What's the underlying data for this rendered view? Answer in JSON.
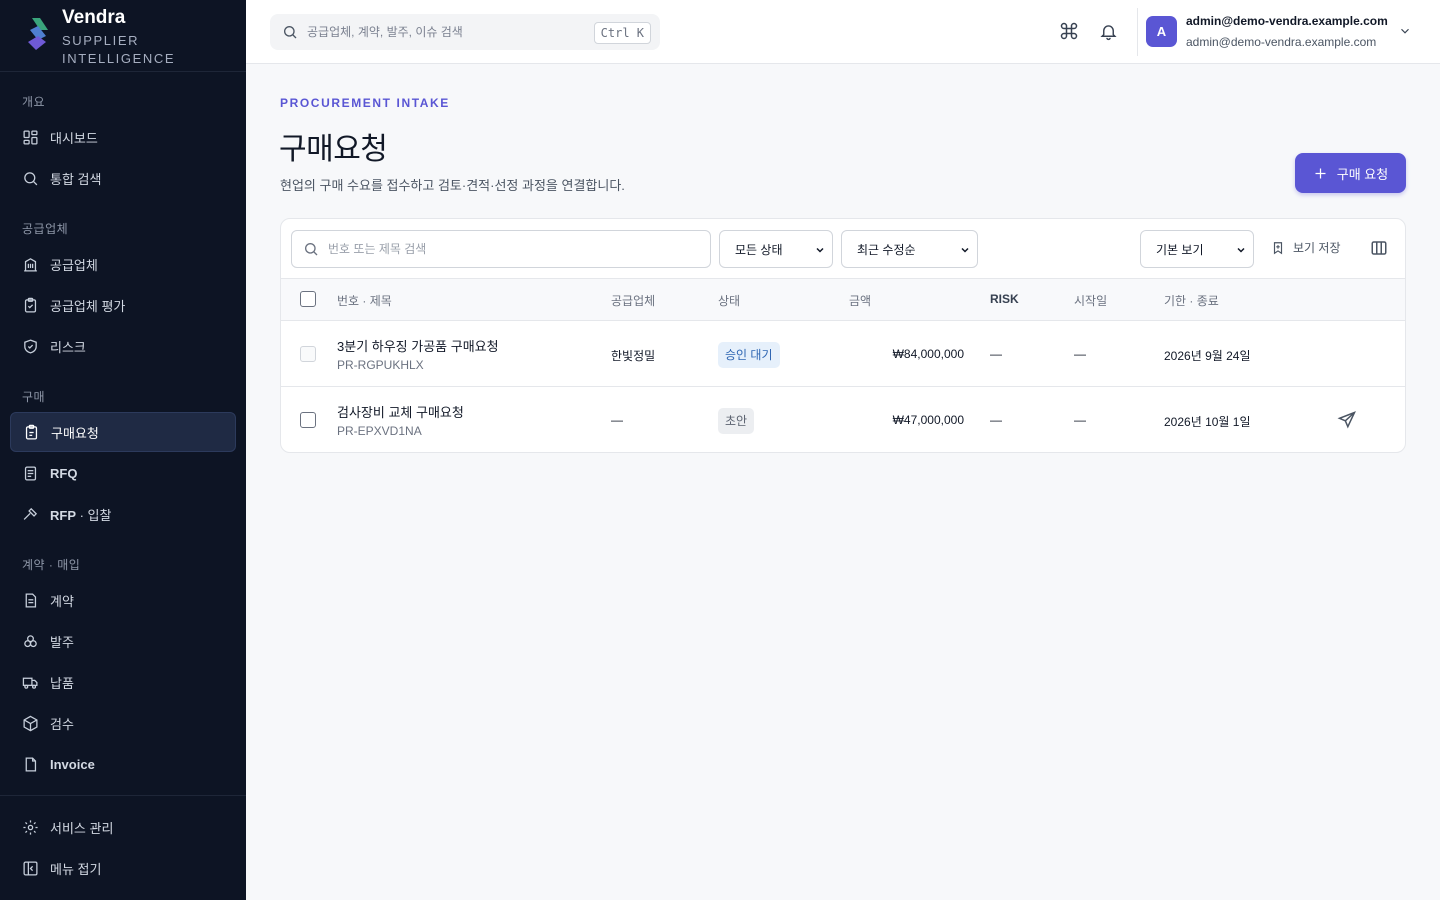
{
  "brand": {
    "name": "Vendra",
    "tagline": "SUPPLIER INTELLIGENCE",
    "logo_colors": [
      "#3aa57c",
      "#6f5ad6"
    ]
  },
  "sidebar": {
    "sections": [
      {
        "title": "개요",
        "items": [
          {
            "label": "대시보드",
            "icon": "dashboard-icon"
          },
          {
            "label": "통합 검색",
            "icon": "search-icon"
          }
        ]
      },
      {
        "title": "공급업체",
        "items": [
          {
            "label": "공급업체",
            "icon": "building-icon"
          },
          {
            "label": "공급업체 평가",
            "icon": "clipboard-check-icon"
          },
          {
            "label": "리스크",
            "icon": "shield-icon"
          }
        ]
      },
      {
        "title": "구매",
        "items": [
          {
            "label": "구매요청",
            "icon": "clipboard-icon",
            "active": true
          },
          {
            "label": "RFQ",
            "icon": "document-icon"
          },
          {
            "label_prefix": "RFP",
            "label_suffix": " · 입찰",
            "icon": "gavel-icon"
          }
        ]
      },
      {
        "title": "계약 · 매입",
        "items": [
          {
            "label": "계약",
            "icon": "contract-icon"
          },
          {
            "label": "발주",
            "icon": "boxes-icon"
          },
          {
            "label": "납품",
            "icon": "truck-icon"
          },
          {
            "label": "검수",
            "icon": "package-icon"
          },
          {
            "label": "Invoice",
            "icon": "invoice-icon"
          }
        ]
      }
    ],
    "footer": [
      {
        "label": "서비스 관리",
        "icon": "gear-icon"
      },
      {
        "label": "메뉴 접기",
        "icon": "collapse-icon"
      }
    ]
  },
  "topbar": {
    "search_placeholder": "공급업체, 계약, 발주, 이슈 검색",
    "shortcut": "Ctrl K",
    "user": {
      "avatar_letter": "A",
      "name": "admin@demo-vendra.example.com",
      "email": "admin@demo-vendra.example.com"
    }
  },
  "page": {
    "eyebrow": "PROCUREMENT INTAKE",
    "title": "구매요청",
    "description": "현업의 구매 수요를 접수하고 검토·견적·선정 과정을 연결합니다.",
    "new_button": "구매 요청"
  },
  "filters": {
    "search_placeholder": "번호 또는 제목 검색",
    "status_selected": "모든 상태",
    "sort_selected": "최근 수정순",
    "view_selected": "기본 보기",
    "save_view_label": "보기 저장"
  },
  "table": {
    "headers": {
      "number_title": "번호 · 제목",
      "supplier": "공급업체",
      "status": "상태",
      "amount": "금액",
      "risk": "RISK",
      "start": "시작일",
      "due": "기한 · 종료"
    },
    "rows": [
      {
        "title": "3분기 하우징 가공품 구매요청",
        "id": "PR-RGPUKHLX",
        "supplier": "한빛정밀",
        "status": "승인 대기",
        "amount": "₩84,000,000",
        "risk": "—",
        "start": "—",
        "due": "2026년 9월 24일"
      },
      {
        "title": "검사장비 교체 구매요청",
        "id": "PR-EPXVD1NA",
        "supplier": "—",
        "status": "초안",
        "amount": "₩47,000,000",
        "risk": "—",
        "start": "—",
        "due": "2026년 10월 1일"
      }
    ]
  },
  "colors": {
    "sidebar_bg": "#0d1424",
    "accent": "#5a56d4",
    "status_pending": "#2f66b3",
    "status_draft": "#5b6270"
  }
}
